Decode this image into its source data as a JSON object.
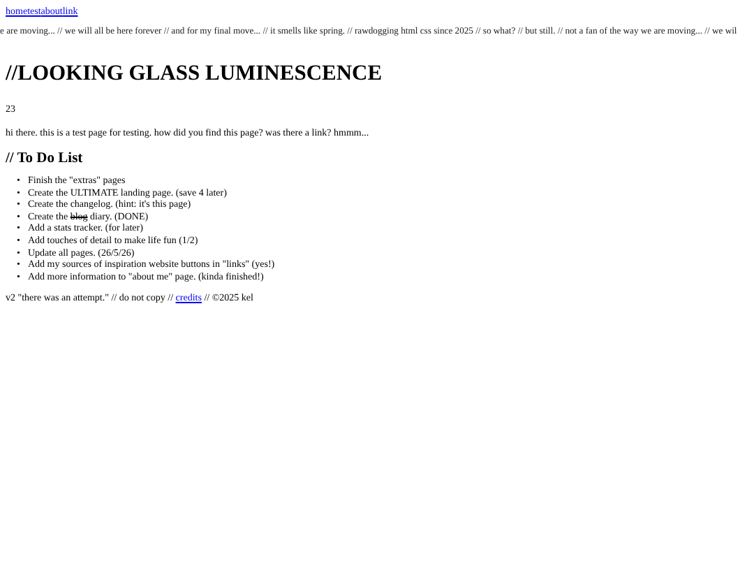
{
  "nav": [
    "home",
    "test",
    "about",
    "link"
  ],
  "ticker": "e are moving... // we will all be here forever // and for my final move... // it smells like spring. // rawdogging html css since 2025 // so what? // but still. // not a fan of the way we are moving... // we wil",
  "title": "//LOOKING GLASS LUMINESCENCE",
  "counter": "23",
  "intro": "hi there. this is a test page for testing. how did you find this page? was there a link? hmmm...",
  "todo": {
    "heading": "// To Do List",
    "marker": "•",
    "items": [
      {
        "text": "Finish the \"extras\" pages"
      },
      {
        "text": "Create the ULTIMATE landing page. (save 4 later)"
      },
      {
        "text": "Create the changelog. (hint: it's this page)"
      },
      {
        "text": "Create the ",
        "struck": "blog",
        "after": " diary. (DONE)"
      },
      {
        "text": "Add a stats tracker. (for later)"
      },
      {
        "text": "Add touches of detail to make life fun (1/2)"
      },
      {
        "text": "Update all pages. (26/5/26)"
      },
      {
        "text": "Add my sources of inspiration website buttons in \"links\" (yes!)"
      },
      {
        "text": "Add more information to \"about me\" page. (kinda finished!)"
      }
    ]
  },
  "footer": {
    "before": "v2 \"there was an attempt.\" // do not copy // ",
    "link": "credits",
    "after": " // ©2025 kel"
  }
}
